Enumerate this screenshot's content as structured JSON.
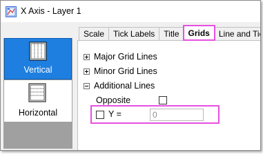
{
  "window": {
    "title": "X Axis - Layer 1"
  },
  "left_panel": {
    "items": [
      {
        "label": "Vertical",
        "icon": "vertical-grid-icon",
        "selected": true
      },
      {
        "label": "Horizontal",
        "icon": "horizontal-grid-icon",
        "selected": false
      }
    ]
  },
  "tabs": [
    {
      "label": "Scale",
      "active": false
    },
    {
      "label": "Tick Labels",
      "active": false
    },
    {
      "label": "Title",
      "active": false
    },
    {
      "label": "Grids",
      "active": true
    },
    {
      "label": "Line and Ticks",
      "active": false
    }
  ],
  "tree": {
    "major": {
      "label": "Major Grid Lines",
      "expanded": false
    },
    "minor": {
      "label": "Minor Grid Lines",
      "expanded": false
    },
    "additional": {
      "label": "Additional Lines",
      "expanded": true
    },
    "opposite": {
      "label": "Opposite",
      "checked": false
    },
    "y": {
      "label": "Y =",
      "checked": false,
      "value": "0"
    }
  },
  "colors": {
    "selection": "#1e7fe0",
    "highlight": "#e84fe0"
  }
}
